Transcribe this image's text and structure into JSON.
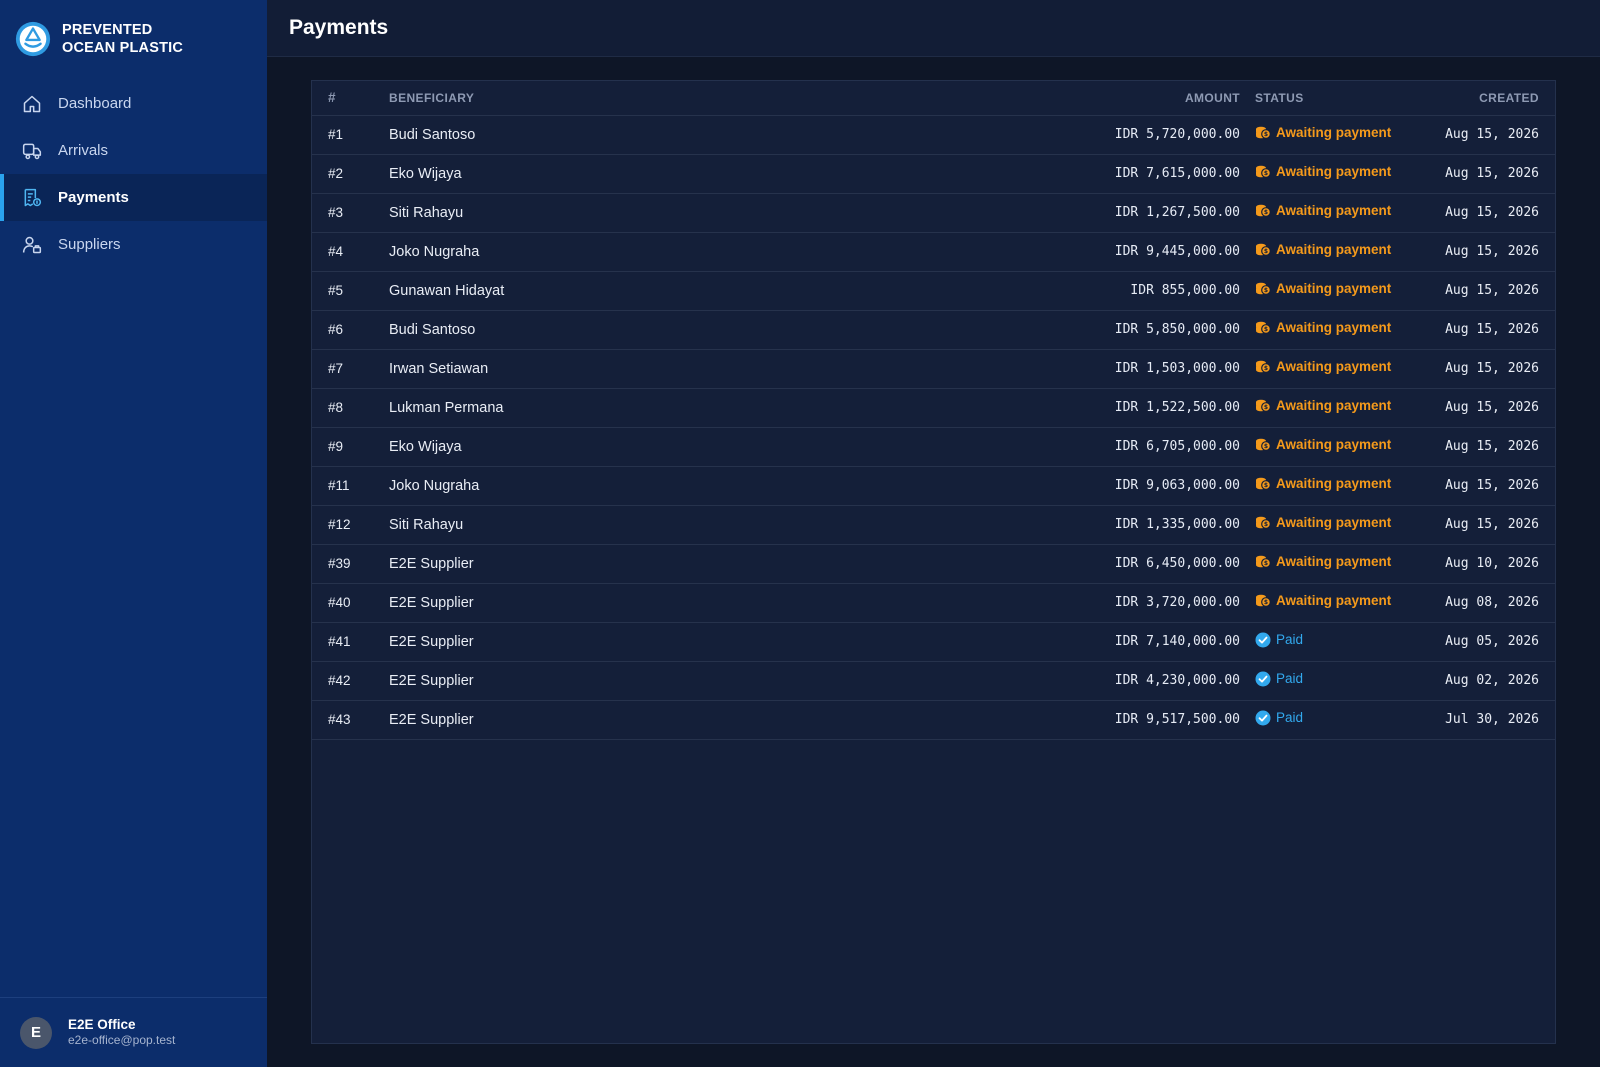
{
  "brand": {
    "name": "PREVENTED\nOCEAN PLASTIC"
  },
  "nav": [
    {
      "label": "Dashboard",
      "icon": "home-icon",
      "active": false
    },
    {
      "label": "Arrivals",
      "icon": "truck-icon",
      "active": false
    },
    {
      "label": "Payments",
      "icon": "payments-icon",
      "active": true
    },
    {
      "label": "Suppliers",
      "icon": "supplier-icon",
      "active": false
    }
  ],
  "user": {
    "initial": "E",
    "name": "E2E Office",
    "email": "e2e-office@pop.test"
  },
  "header": {
    "title": "Payments"
  },
  "table": {
    "columns": [
      "#",
      "BENEFICIARY",
      "AMOUNT",
      "STATUS",
      "CREATED"
    ],
    "rows": [
      {
        "id": "#1",
        "beneficiary": "Budi Santoso",
        "amount": "IDR 5,720,000.00",
        "status": "Awaiting payment",
        "created": "Aug 15, 2026"
      },
      {
        "id": "#2",
        "beneficiary": "Eko Wijaya",
        "amount": "IDR 7,615,000.00",
        "status": "Awaiting payment",
        "created": "Aug 15, 2026"
      },
      {
        "id": "#3",
        "beneficiary": "Siti Rahayu",
        "amount": "IDR 1,267,500.00",
        "status": "Awaiting payment",
        "created": "Aug 15, 2026"
      },
      {
        "id": "#4",
        "beneficiary": "Joko Nugraha",
        "amount": "IDR 9,445,000.00",
        "status": "Awaiting payment",
        "created": "Aug 15, 2026"
      },
      {
        "id": "#5",
        "beneficiary": "Gunawan Hidayat",
        "amount": "IDR 855,000.00",
        "status": "Awaiting payment",
        "created": "Aug 15, 2026"
      },
      {
        "id": "#6",
        "beneficiary": "Budi Santoso",
        "amount": "IDR 5,850,000.00",
        "status": "Awaiting payment",
        "created": "Aug 15, 2026"
      },
      {
        "id": "#7",
        "beneficiary": "Irwan Setiawan",
        "amount": "IDR 1,503,000.00",
        "status": "Awaiting payment",
        "created": "Aug 15, 2026"
      },
      {
        "id": "#8",
        "beneficiary": "Lukman Permana",
        "amount": "IDR 1,522,500.00",
        "status": "Awaiting payment",
        "created": "Aug 15, 2026"
      },
      {
        "id": "#9",
        "beneficiary": "Eko Wijaya",
        "amount": "IDR 6,705,000.00",
        "status": "Awaiting payment",
        "created": "Aug 15, 2026"
      },
      {
        "id": "#11",
        "beneficiary": "Joko Nugraha",
        "amount": "IDR 9,063,000.00",
        "status": "Awaiting payment",
        "created": "Aug 15, 2026"
      },
      {
        "id": "#12",
        "beneficiary": "Siti Rahayu",
        "amount": "IDR 1,335,000.00",
        "status": "Awaiting payment",
        "created": "Aug 15, 2026"
      },
      {
        "id": "#39",
        "beneficiary": "E2E Supplier",
        "amount": "IDR 6,450,000.00",
        "status": "Awaiting payment",
        "created": "Aug 10, 2026"
      },
      {
        "id": "#40",
        "beneficiary": "E2E Supplier",
        "amount": "IDR 3,720,000.00",
        "status": "Awaiting payment",
        "created": "Aug 08, 2026"
      },
      {
        "id": "#41",
        "beneficiary": "E2E Supplier",
        "amount": "IDR 7,140,000.00",
        "status": "Paid",
        "created": "Aug 05, 2026"
      },
      {
        "id": "#42",
        "beneficiary": "E2E Supplier",
        "amount": "IDR 4,230,000.00",
        "status": "Paid",
        "created": "Aug 02, 2026"
      },
      {
        "id": "#43",
        "beneficiary": "E2E Supplier",
        "amount": "IDR 9,517,500.00",
        "status": "Paid",
        "created": "Jul 30, 2026"
      }
    ]
  },
  "colors": {
    "awaiting": "#f59a1b",
    "paid": "#32a9ee",
    "accent": "#2aa3ee",
    "sidebar": "#0c2d6b"
  }
}
